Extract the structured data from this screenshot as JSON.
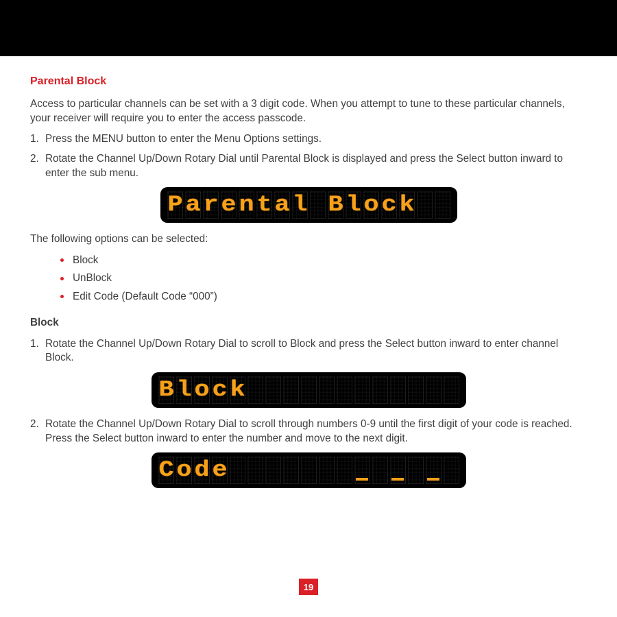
{
  "title": "Parental Block",
  "intro": "Access to particular channels can be set with a 3 digit code. When you attempt to tune to these particular channels, your receiver will require you to enter the access passcode.",
  "steps_a": [
    "Press the MENU button to enter the Menu Options settings.",
    "Rotate the Channel Up/Down Rotary Dial until Parental Block is displayed and press the Select button inward to enter the sub menu."
  ],
  "led1": "Parental Block",
  "options_intro": "The following options can be selected:",
  "bullets": [
    "Block",
    "UnBlock",
    "Edit Code (Default Code “000”)"
  ],
  "subhead": "Block",
  "steps_b1": "Rotate the Channel Up/Down Rotary Dial to scroll to Block and press the Select button inward to enter channel Block.",
  "led2": "Block",
  "steps_b2": "Rotate the Channel Up/Down Rotary Dial to scroll through numbers 0-9 until the first digit of your code is reached. Press the Select button inward to enter the number and move to the next digit.",
  "led3": "Code",
  "page_number": "19",
  "led_total_cells": {
    "panel1": 16,
    "panel2": 17,
    "panel3": 17
  },
  "led3_underscore_positions": [
    12,
    14,
    16
  ]
}
